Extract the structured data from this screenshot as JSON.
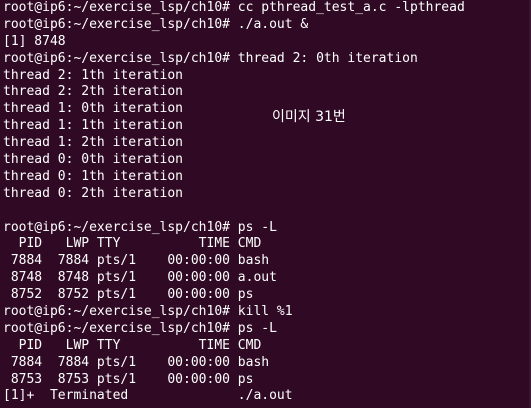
{
  "terminal": {
    "lines": [
      "root@ip6:~/exercise_lsp/ch10# cc pthread_test_a.c -lpthread",
      "root@ip6:~/exercise_lsp/ch10# ./a.out &",
      "[1] 8748",
      "root@ip6:~/exercise_lsp/ch10# thread 2: 0th iteration",
      "thread 2: 1th iteration",
      "thread 2: 2th iteration",
      "thread 1: 0th iteration",
      "thread 1: 1th iteration",
      "thread 1: 2th iteration",
      "thread 0: 0th iteration",
      "thread 0: 1th iteration",
      "thread 0: 2th iteration",
      "",
      "root@ip6:~/exercise_lsp/ch10# ps -L",
      "  PID   LWP TTY          TIME CMD",
      " 7884  7884 pts/1    00:00:00 bash",
      " 8748  8748 pts/1    00:00:00 a.out",
      " 8752  8752 pts/1    00:00:00 ps",
      "root@ip6:~/exercise_lsp/ch10# kill %1",
      "root@ip6:~/exercise_lsp/ch10# ps -L",
      "  PID   LWP TTY          TIME CMD",
      " 7884  7884 pts/1    00:00:00 bash",
      " 8753  8753 pts/1    00:00:00 ps",
      "[1]+  Terminated              ./a.out"
    ],
    "overlay_label": "이미지 31번"
  },
  "colors": {
    "background": "#300a24",
    "foreground": "#ffffff"
  }
}
